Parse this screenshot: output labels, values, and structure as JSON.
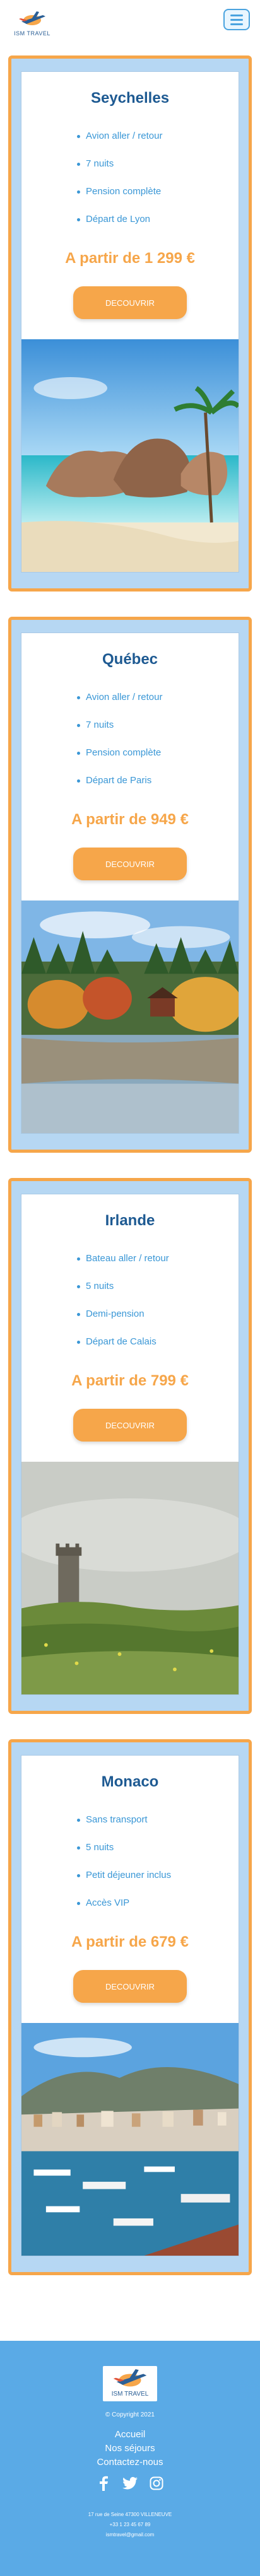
{
  "header": {
    "logo_text": "ISM TRAVEL",
    "menu_icon": "hamburger-menu-icon"
  },
  "cards": [
    {
      "title": "Seychelles",
      "features": [
        "Avion aller / retour",
        "7 nuits",
        "Pension complète",
        "Départ de Lyon"
      ],
      "price": "A partir de 1 299 €",
      "button": "DECOUVRIR"
    },
    {
      "title": "Québec",
      "features": [
        "Avion aller / retour",
        "7 nuits",
        "Pension complète",
        "Départ de Paris"
      ],
      "price": "A partir de 949 €",
      "button": "DECOUVRIR"
    },
    {
      "title": "Irlande",
      "features": [
        "Bateau aller / retour",
        "5 nuits",
        "Demi-pension",
        "Départ de Calais"
      ],
      "price": "A partir de 799 €",
      "button": "DECOUVRIR"
    },
    {
      "title": "Monaco",
      "features": [
        "Sans transport",
        "5 nuits",
        "Petit déjeuner inclus",
        "Accès VIP"
      ],
      "price": "A partir de 679 €",
      "button": "DECOUVRIR"
    }
  ],
  "footer": {
    "logo_text": "ISM TRAVEL",
    "copyright": "© Copyright 2021",
    "links": [
      "Accueil",
      "Nos séjours",
      "Contactez-nous"
    ],
    "socials": [
      "facebook-icon",
      "twitter-icon",
      "instagram-icon"
    ],
    "address": "17 rue de Seine 47300 VILLENEUVE",
    "phone": "+33 1 23 45 67 89",
    "email": "ismtravel@gmail.com"
  },
  "colors": {
    "accent_orange": "#f6a64a",
    "title_blue": "#1e5a92",
    "feature_blue": "#3a97d6",
    "card_bg": "#b6d7f3",
    "footer_bg": "#5aaae6"
  }
}
